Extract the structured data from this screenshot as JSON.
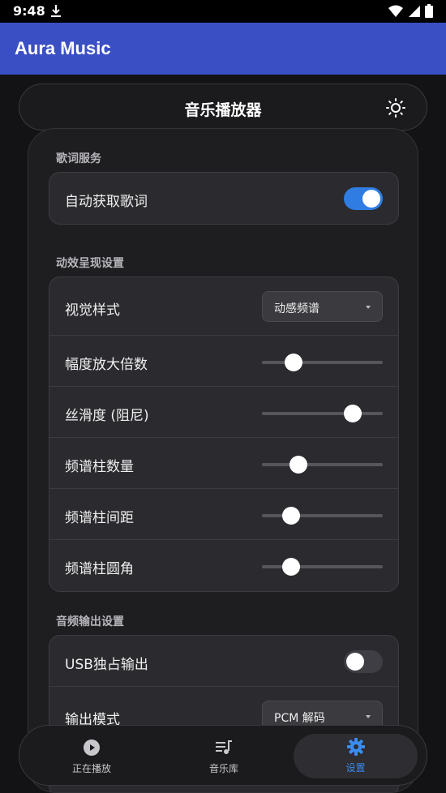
{
  "status_bar": {
    "time": "9:48"
  },
  "app_bar": {
    "title": "Aura Music"
  },
  "header": {
    "title": "音乐播放器",
    "icon": "sun-icon"
  },
  "sections": {
    "lyrics": {
      "title": "歌词服务",
      "auto_lyrics": {
        "label": "自动获取歌词",
        "enabled": true
      }
    },
    "visual": {
      "title": "动效呈现设置",
      "style": {
        "label": "视觉样式",
        "value": "动感频谱"
      },
      "amplitude": {
        "label": "幅度放大倍数",
        "level": 0.26
      },
      "smoothing": {
        "label": "丝滑度 (阻尼)",
        "level": 0.75
      },
      "bar_count": {
        "label": "频谱柱数量",
        "level": 0.3
      },
      "bar_spacing": {
        "label": "频谱柱间距",
        "level": 0.24
      },
      "bar_radius": {
        "label": "频谱柱圆角",
        "level": 0.24
      }
    },
    "audio": {
      "title": "音频输出设置",
      "usb_exclusive": {
        "label": "USB独占输出",
        "enabled": false
      },
      "output_mode": {
        "label": "输出模式",
        "value": "PCM 解码"
      }
    }
  },
  "bottom_nav": {
    "now_playing": "正在播放",
    "library": "音乐库",
    "settings": "设置"
  },
  "colors": {
    "accent": "#2f7de2",
    "app_bar": "#3a4fc4",
    "nav_active": "#3b8cf0"
  }
}
